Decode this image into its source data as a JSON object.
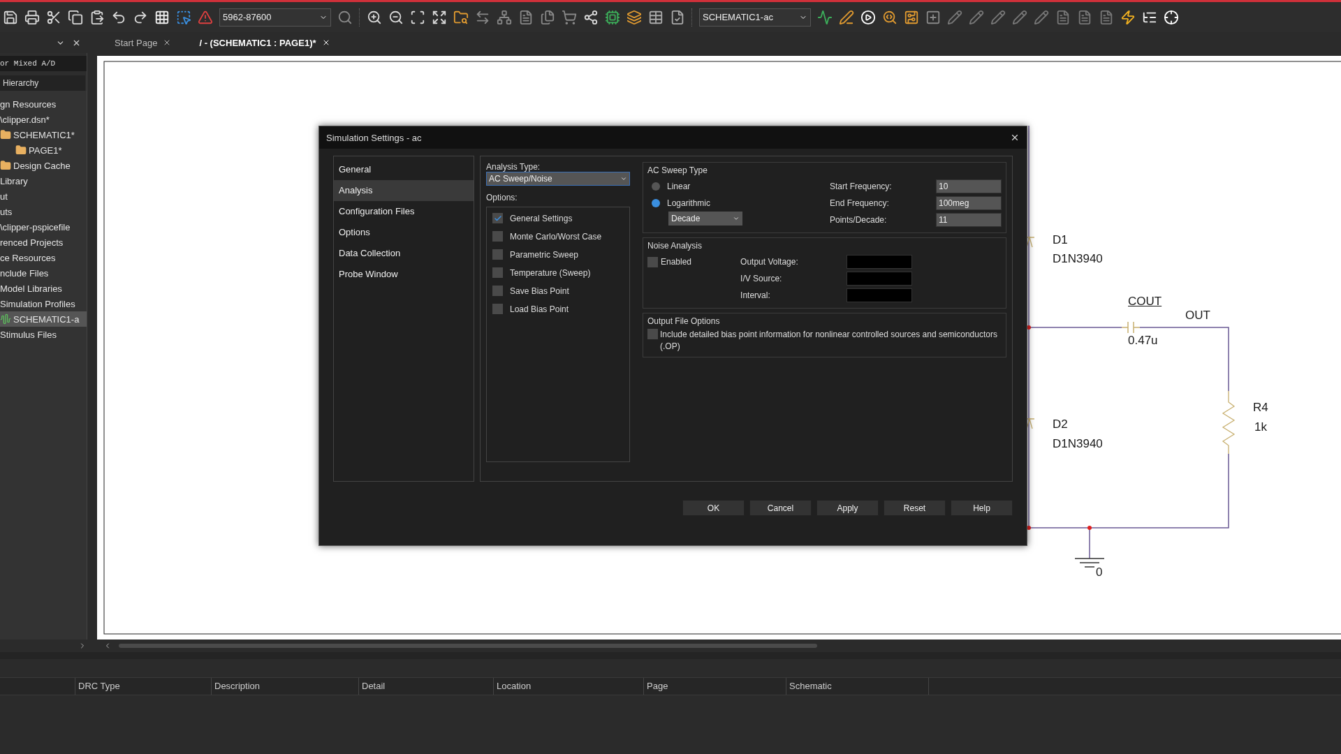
{
  "toolbar": {
    "part_field": "5962-87600",
    "profile_field": "SCHEMATIC1-ac"
  },
  "tabs": [
    {
      "label": "Start Page",
      "selected": false
    },
    {
      "label": "/ - (SCHEMATIC1 : PAGE1)*",
      "selected": true
    }
  ],
  "project_panel": {
    "title": "or Mixed A/D",
    "tab": "Hierarchy",
    "tree": [
      {
        "label": "gn Resources",
        "selected": false
      },
      {
        "label": "\\clipper.dsn*",
        "selected": false
      },
      {
        "label": "SCHEMATIC1*",
        "kind": "folder",
        "selected": false,
        "children": [
          {
            "label": "PAGE1*",
            "kind": "folder",
            "selected": false
          }
        ]
      },
      {
        "label": "Design Cache",
        "kind": "folder",
        "selected": false
      },
      {
        "label": "Library",
        "selected": false
      },
      {
        "label": "ut",
        "selected": false
      },
      {
        "label": "uts",
        "selected": false
      },
      {
        "label": "\\clipper-pspicefile",
        "selected": false
      },
      {
        "label": "renced Projects",
        "selected": false
      },
      {
        "label": "ce Resources",
        "selected": false
      },
      {
        "label": "nclude Files",
        "selected": false
      },
      {
        "label": "Model Libraries",
        "selected": false
      },
      {
        "label": "Simulation Profiles",
        "selected": false
      },
      {
        "label": "SCHEMATIC1-a",
        "kind": "profile",
        "selected": true
      },
      {
        "label": "Stimulus Files",
        "selected": false
      }
    ]
  },
  "schematic": {
    "labels": [
      {
        "text": "D1",
        "underline": false
      },
      {
        "text": "D1N3940",
        "underline": false
      },
      {
        "text": "COUT",
        "underline": true
      },
      {
        "text": "OUT",
        "underline": false
      },
      {
        "text": "0.47u",
        "underline": false
      },
      {
        "text": "D2",
        "underline": false
      },
      {
        "text": "D1N3940",
        "underline": false
      },
      {
        "text": "R4",
        "underline": false
      },
      {
        "text": "1k",
        "underline": false
      },
      {
        "text": "0",
        "underline": false
      }
    ]
  },
  "dialog": {
    "title": "Simulation Settings - ac",
    "nav": [
      {
        "label": "General",
        "selected": false
      },
      {
        "label": "Analysis",
        "selected": true
      },
      {
        "label": "Configuration Files",
        "selected": false
      },
      {
        "label": "Options",
        "selected": false
      },
      {
        "label": "Data Collection",
        "selected": false
      },
      {
        "label": "Probe Window",
        "selected": false
      }
    ],
    "analysis_type": {
      "label": "Analysis Type:",
      "value": "AC Sweep/Noise"
    },
    "options": {
      "label": "Options:",
      "items": [
        {
          "label": "General Settings",
          "checked": true
        },
        {
          "label": "Monte Carlo/Worst Case",
          "checked": false
        },
        {
          "label": "Parametric Sweep",
          "checked": false
        },
        {
          "label": "Temperature (Sweep)",
          "checked": false
        },
        {
          "label": "Save Bias Point",
          "checked": false
        },
        {
          "label": "Load Bias Point",
          "checked": false
        }
      ]
    },
    "ac_sweep": {
      "legend": "AC Sweep Type",
      "radios": [
        {
          "label": "Linear",
          "selected": false
        },
        {
          "label": "Logarithmic",
          "selected": true
        }
      ],
      "scale": "Decade",
      "fields": [
        {
          "label": "Start Frequency:",
          "value": "10"
        },
        {
          "label": "End Frequency:",
          "value": "100meg"
        },
        {
          "label": "Points/Decade:",
          "value": "11"
        }
      ]
    },
    "noise": {
      "legend": "Noise Analysis",
      "enabled": {
        "label": "Enabled",
        "checked": false
      },
      "fields": [
        {
          "label": "Output Voltage:"
        },
        {
          "label": "I/V Source:"
        },
        {
          "label": "Interval:"
        }
      ]
    },
    "output_file": {
      "legend": "Output File Options",
      "option": {
        "label": "Include detailed bias point information for nonlinear controlled sources and semiconductors (.OP)",
        "checked": false
      }
    },
    "buttons": [
      "OK",
      "Cancel",
      "Apply",
      "Reset",
      "Help"
    ]
  },
  "drc_table": {
    "columns": [
      "",
      "DRC Type",
      "Description",
      "Detail",
      "Location",
      "Page",
      "Schematic"
    ]
  }
}
